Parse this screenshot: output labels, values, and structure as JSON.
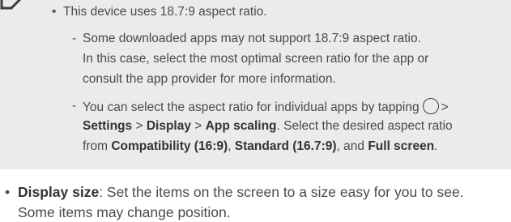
{
  "note": {
    "icon": "note-pencil-icon",
    "bullet": "•",
    "dash": "-",
    "item1": "This device uses 18.7:9 aspect ratio.",
    "sub1_lines": [
      "Some downloaded apps may not support 18.7:9 aspect ratio.",
      "In this case, select the most optimal screen ratio for the app or",
      "consult the app provider for more information."
    ],
    "sub2": {
      "line1_text": "You can select the aspect ratio for individual apps by tapping",
      "circle_icon": "home-circle-icon",
      "gt": ">",
      "settings": "Settings",
      "display": "Display",
      "app_scaling": "App scaling",
      "line2_tail": ". Select the desired aspect ratio",
      "line3_from": "from",
      "compat": "Compatibility (16:9)",
      "comma1": ",",
      "standard": "Standard (16.7:9)",
      "and": ", and",
      "full": "Full screen",
      "period": "."
    }
  },
  "main": {
    "bullet": "•",
    "term": "Display size",
    "desc_line1": ": Set the items on the screen to a size easy for you to see.",
    "desc_line2": "Some items may change position."
  }
}
